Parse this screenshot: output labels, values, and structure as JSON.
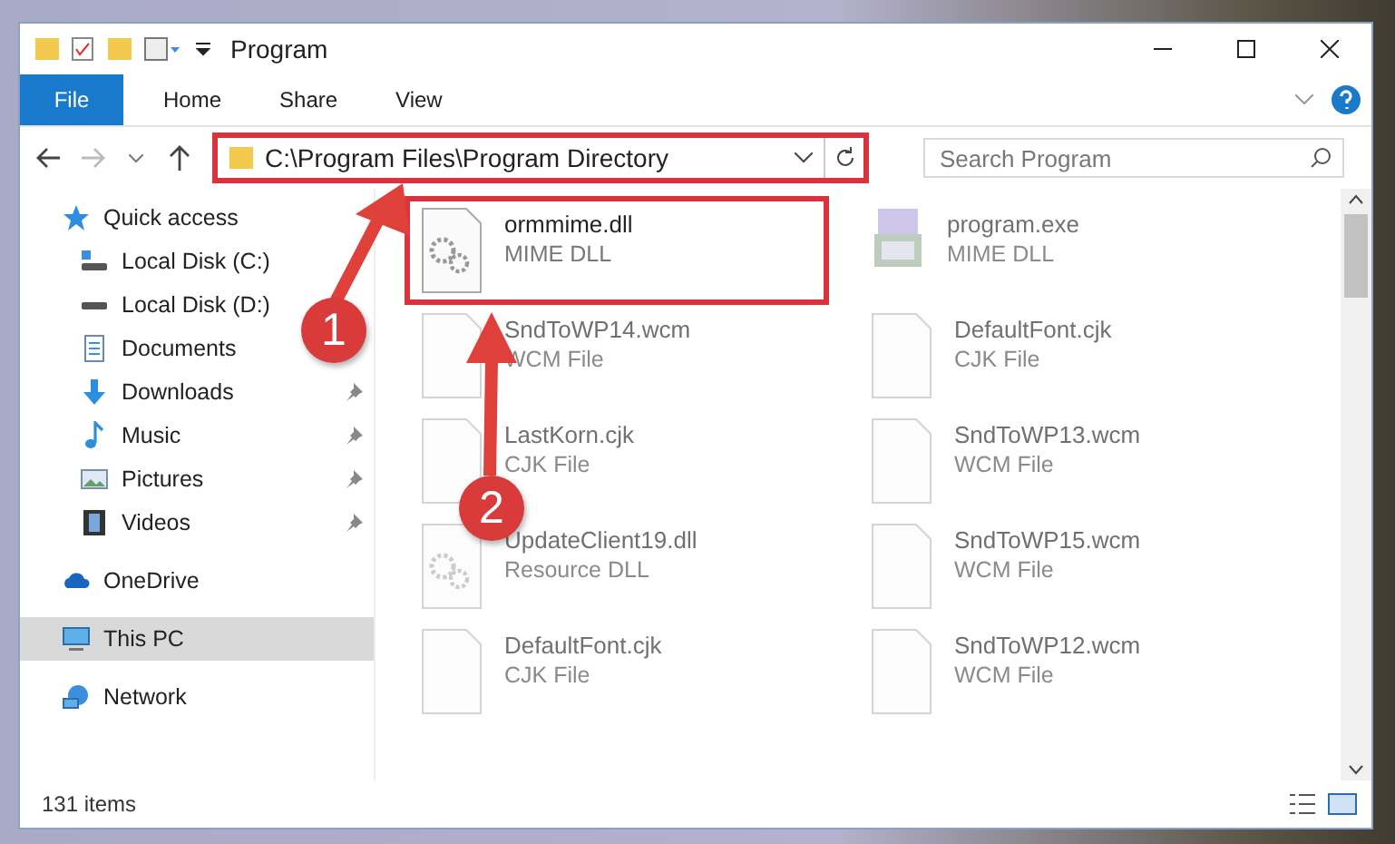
{
  "window": {
    "title": "Program"
  },
  "ribbon_tabs": [
    {
      "label": "File",
      "selected": true
    },
    {
      "label": "Home",
      "selected": false
    },
    {
      "label": "Share",
      "selected": false
    },
    {
      "label": "View",
      "selected": false
    }
  ],
  "address": {
    "path": "C:\\Program Files\\Program Directory",
    "highlighted": true
  },
  "search": {
    "placeholder": "Search Program"
  },
  "sidebar": {
    "items": [
      {
        "label": "Quick access",
        "kind": "star",
        "selected": false,
        "children": [
          {
            "label": "Local Disk (C:)",
            "kind": "disk-c",
            "selected": false,
            "pinned": false
          },
          {
            "label": "Local Disk (D:)",
            "kind": "disk",
            "selected": false,
            "pinned": false
          },
          {
            "label": "Documents",
            "kind": "documents",
            "selected": false,
            "pinned": false
          },
          {
            "label": "Downloads",
            "kind": "downloads",
            "selected": false,
            "pinned": true
          },
          {
            "label": "Music",
            "kind": "music",
            "selected": false,
            "pinned": true
          },
          {
            "label": "Pictures",
            "kind": "pictures",
            "selected": false,
            "pinned": true
          },
          {
            "label": "Videos",
            "kind": "videos",
            "selected": false,
            "pinned": true
          }
        ]
      },
      {
        "label": "OneDrive",
        "kind": "cloud",
        "selected": false
      },
      {
        "label": "This PC",
        "kind": "pc",
        "selected": true
      },
      {
        "label": "Network",
        "kind": "network",
        "selected": false
      }
    ]
  },
  "files": [
    {
      "name": "ormmime.dll",
      "type": "MIME DLL",
      "kind": "gear",
      "highlighted": true,
      "blurred": false
    },
    {
      "name": "program.exe",
      "type": "MIME DLL",
      "kind": "exe",
      "highlighted": false,
      "blurred": true
    },
    {
      "name": "SndToWP14.wcm",
      "type": "WCM File",
      "kind": "blank",
      "highlighted": false,
      "blurred": true
    },
    {
      "name": "DefaultFont.cjk",
      "type": "CJK File",
      "kind": "blank",
      "highlighted": false,
      "blurred": true
    },
    {
      "name": "LastKorn.cjk",
      "type": "CJK File",
      "kind": "blank",
      "highlighted": false,
      "blurred": true
    },
    {
      "name": "SndToWP13.wcm",
      "type": "WCM File",
      "kind": "blank",
      "highlighted": false,
      "blurred": true
    },
    {
      "name": "UpdateClient19.dll",
      "type": "Resource DLL",
      "kind": "gear",
      "highlighted": false,
      "blurred": true
    },
    {
      "name": "SndToWP15.wcm",
      "type": "WCM File",
      "kind": "blank",
      "highlighted": false,
      "blurred": true
    },
    {
      "name": "DefaultFont.cjk",
      "type": "CJK File",
      "kind": "blank",
      "highlighted": false,
      "blurred": true
    },
    {
      "name": "SndToWP12.wcm",
      "type": "WCM File",
      "kind": "blank",
      "highlighted": false,
      "blurred": true
    }
  ],
  "callouts": [
    "1",
    "2"
  ],
  "status_bar": {
    "count": "131 items"
  }
}
